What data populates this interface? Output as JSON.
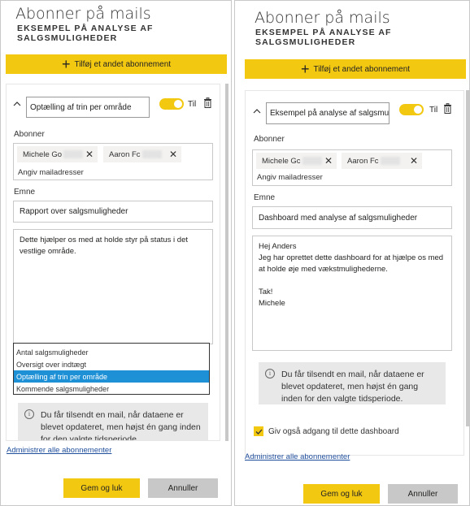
{
  "left": {
    "title": "Abonner på mails",
    "subtitle": "EKSEMPEL PÅ ANALYSE AF SALGSMULIGHEDER",
    "add_button": "Tilføj et andet abonnement",
    "subscription_name": "Optælling af trin per område",
    "toggle_label": "Til",
    "subscribers_label": "Abonner",
    "recipients": [
      {
        "name": "Michele Go"
      },
      {
        "name": "Aaron Fc"
      }
    ],
    "recipients_placeholder": "Angiv mailadresser",
    "subject_label": "Emne",
    "subject_value": "Rapport over salgsmuligheder",
    "message": "Dette hjælper os med at holde styr på status i det vestlige område.",
    "page_options": [
      {
        "label": "Antal salgsmuligheder",
        "selected": false
      },
      {
        "label": "Oversigt over indtægt",
        "selected": false
      },
      {
        "label": "Optælling af trin per område",
        "selected": true
      },
      {
        "label": "Kommende salgsmuligheder",
        "selected": false
      }
    ],
    "info_text": "Du får tilsendt en mail, når dataene er blevet opdateret, men højst én gang inden for den valgte tidsperiode.",
    "manage_link": "Administrer alle abonnementer",
    "save_button": "Gem og luk",
    "cancel_button": "Annuller"
  },
  "right": {
    "title": "Abonner på mails",
    "subtitle": "EKSEMPEL PÅ ANALYSE AF SALGSMULIGHEDER",
    "add_button": "Tilføj et andet abonnement",
    "subscription_name": "Eksempel på analyse af salgsmuligheder",
    "toggle_label": "Til",
    "subscribers_label": "Abonner",
    "recipients": [
      {
        "name": "Michele Gc"
      },
      {
        "name": "Aaron Fc"
      }
    ],
    "recipients_placeholder": "Angiv mailadresser",
    "subject_label": "Emne",
    "subject_value": "Dashboard med analyse af salgsmuligheder",
    "message": "Hej Anders\nJeg har oprettet dette dashboard for at hjælpe os med at holde øje med vækstmulighederne.\n\nTak!\nMichele",
    "info_text": "Du får tilsendt en mail, når dataene er blevet opdateret, men højst én gang inden for den valgte tidsperiode.",
    "access_checkbox_label": "Giv også adgang til dette dashboard",
    "access_checked": true,
    "manage_link": "Administrer alle abonnementer",
    "save_button": "Gem og luk",
    "cancel_button": "Annuller"
  },
  "colors": {
    "accent": "#f2c811",
    "selected_item": "#1e90d6",
    "link": "#1f4e9c",
    "info_bg": "#e8e8e8",
    "secondary_button": "#c8c8c8"
  },
  "icons": [
    "plus-icon",
    "chevron-up-icon",
    "trash-icon",
    "close-icon",
    "info-icon",
    "checkmark-icon"
  ]
}
